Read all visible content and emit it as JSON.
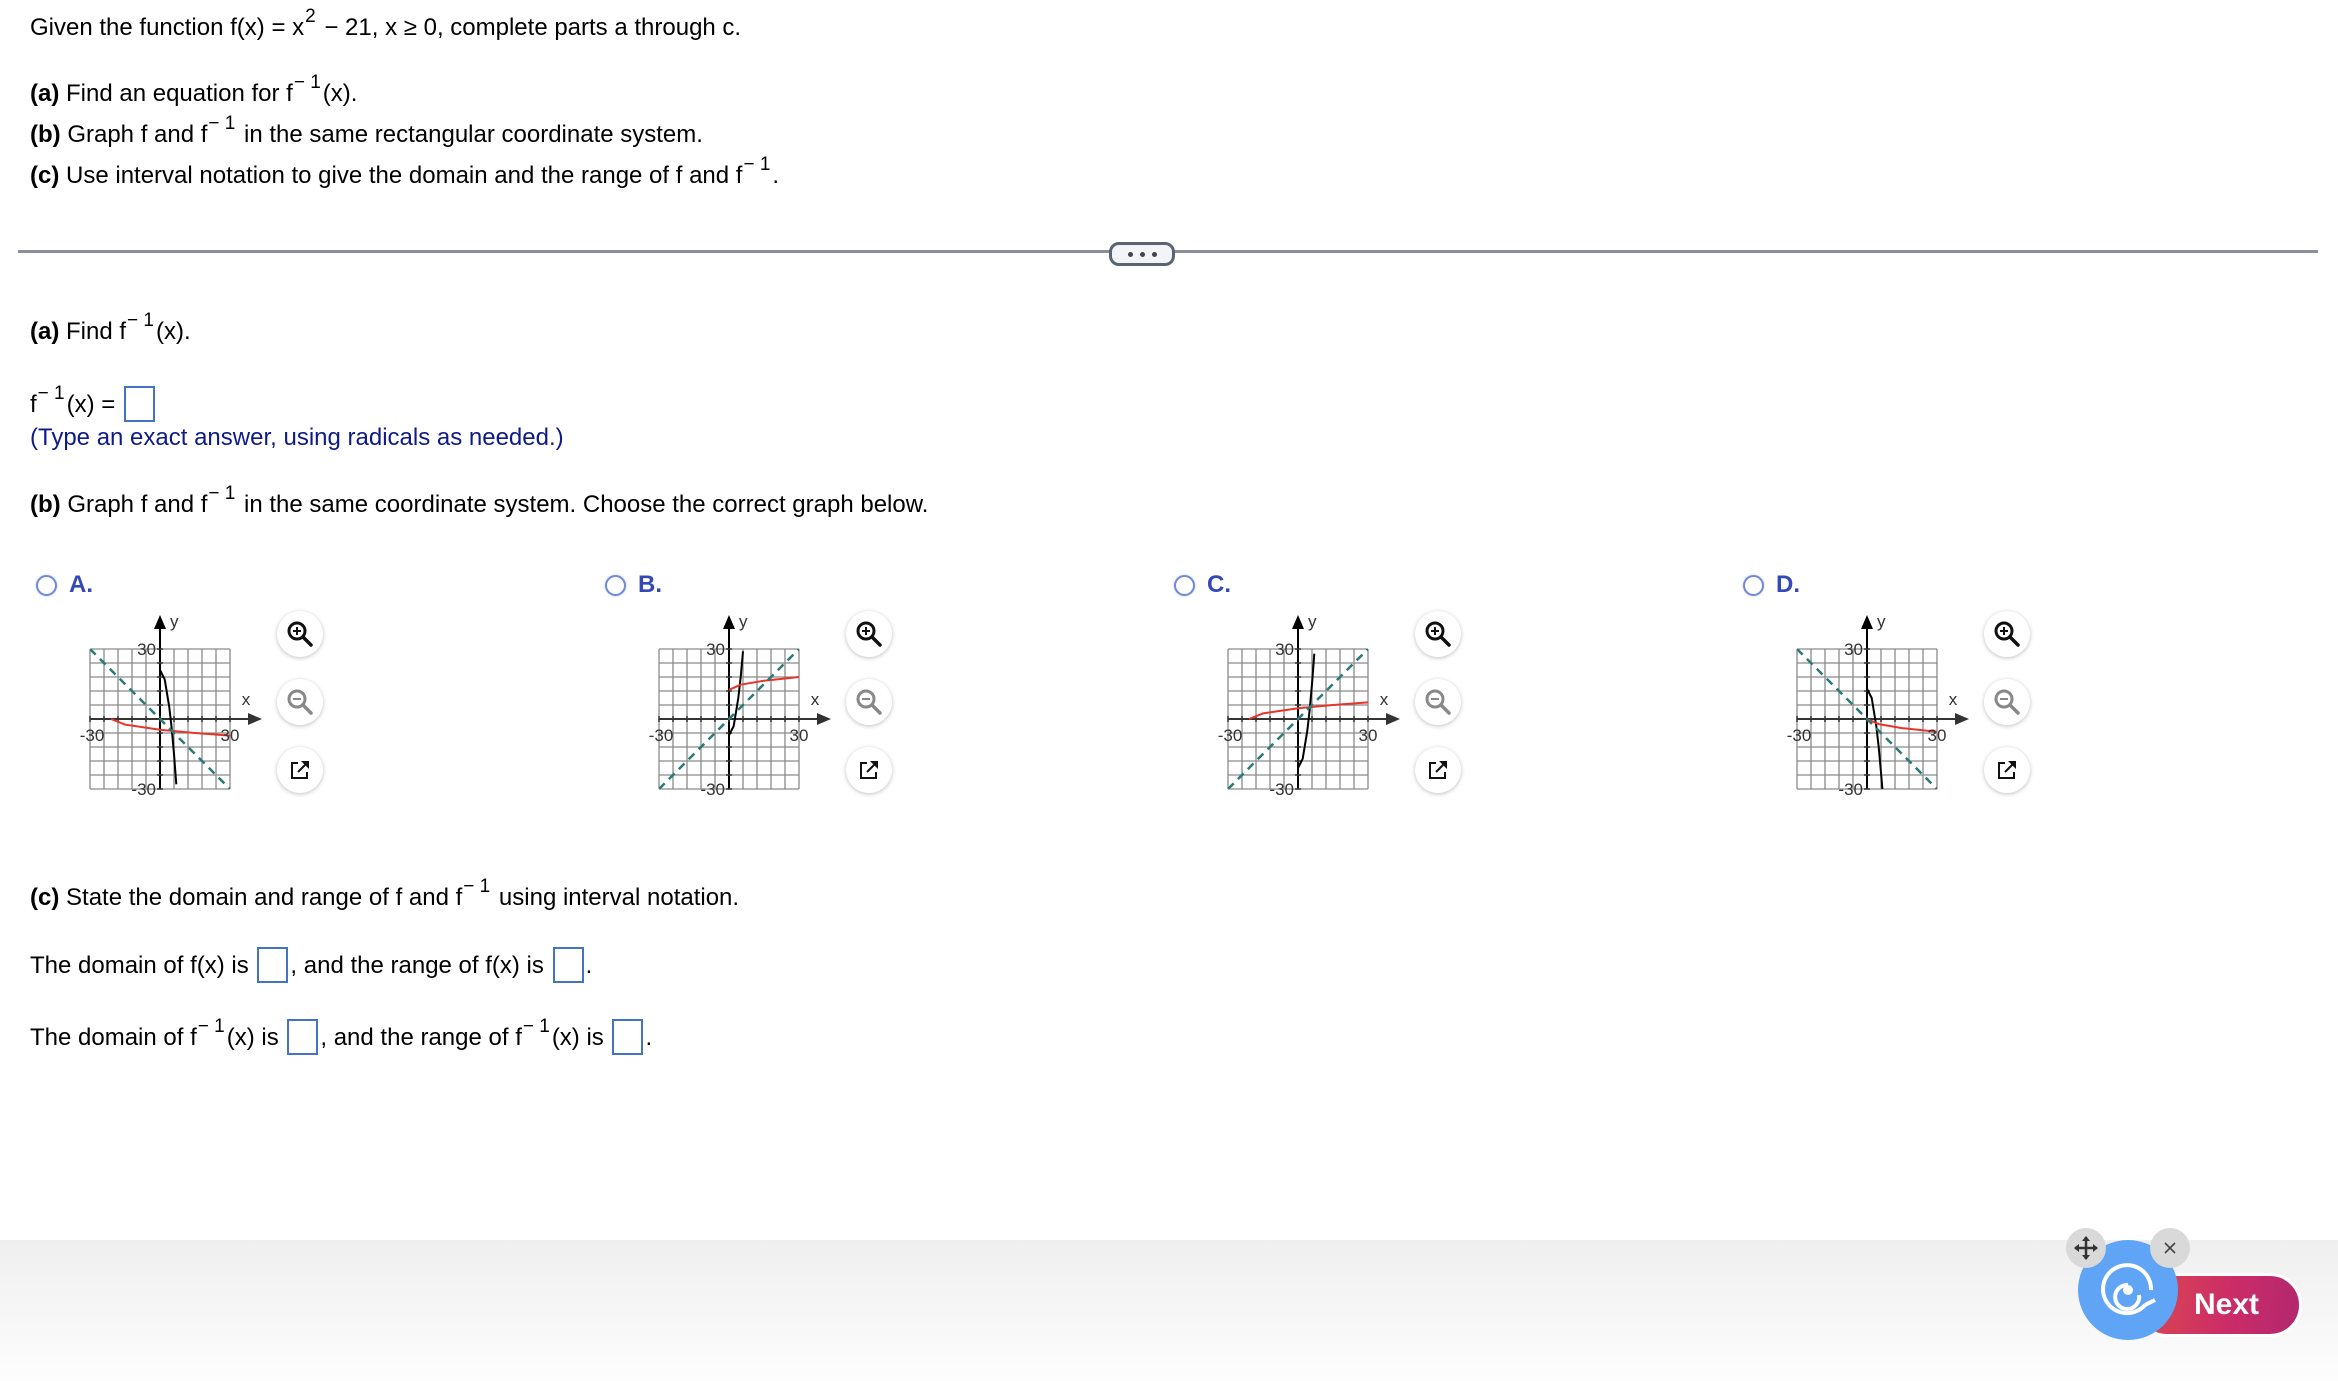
{
  "question": {
    "intro_pre": "Given the function f(x) = x",
    "intro_exp": "2",
    "intro_post": " − 21, x ≥ 0, complete parts a through c.",
    "parts": [
      {
        "letter": "(a)",
        "pre": " Find an equation for f",
        "sup": "− 1",
        "post": "(x)."
      },
      {
        "letter": "(b)",
        "pre": " Graph f and f",
        "sup": "− 1",
        "post": " in the same rectangular coordinate system."
      },
      {
        "letter": "(c)",
        "pre": " Use interval notation to give the domain and the range of f and f",
        "sup": "− 1",
        "post": "."
      }
    ]
  },
  "divider": {
    "more_label": "..."
  },
  "part_a": {
    "heading_letter": "(a)",
    "heading_pre": " Find f",
    "heading_sup": "− 1",
    "heading_post": "(x).",
    "eq_pre": "f",
    "eq_sup": "− 1",
    "eq_post": "(x) =",
    "answer_value": "",
    "hint": "(Type an exact answer, using radicals as needed.)"
  },
  "part_b": {
    "heading_letter": "(b)",
    "heading_pre": " Graph f and f",
    "heading_sup": "− 1",
    "heading_post": " in the same coordinate system. Choose the correct graph below.",
    "options": [
      {
        "label": "A.",
        "selected": false
      },
      {
        "label": "B.",
        "selected": false
      },
      {
        "label": "C.",
        "selected": false
      },
      {
        "label": "D.",
        "selected": false
      }
    ],
    "graph_axis": {
      "xlabel": "x",
      "ylabel": "y",
      "min_label": "-30",
      "max_label": "30",
      "neg_y_label": "-30",
      "pos_y_label": "30"
    },
    "graph_icons": [
      "zoom-in-icon",
      "zoom-out-icon",
      "external-link-icon"
    ]
  },
  "chart_data": [
    {
      "type": "line",
      "title": "Option A",
      "xlim": [
        -30,
        30
      ],
      "ylim": [
        -30,
        30
      ],
      "grid": true,
      "grid_step": 6,
      "series": [
        {
          "name": "black curve",
          "color": "#000000",
          "formula": "y = 21 - x^2, x >= 0",
          "points": [
            [
              0,
              21
            ],
            [
              2,
              17
            ],
            [
              4,
              5
            ],
            [
              5,
              -4
            ],
            [
              6,
              -15
            ],
            [
              7,
              -28
            ]
          ]
        },
        {
          "name": "red curve",
          "color": "#e8342b",
          "formula": "y = -sqrt(x + 21), x >= -21",
          "points": [
            [
              -21,
              0
            ],
            [
              -15,
              -2.4
            ],
            [
              0,
              -4.6
            ],
            [
              15,
              -6
            ],
            [
              30,
              -7.1
            ]
          ]
        },
        {
          "name": "dashed line",
          "color": "#2b7a78",
          "formula": "y = -x",
          "dashed": true,
          "points": [
            [
              -30,
              30
            ],
            [
              30,
              -30
            ]
          ]
        }
      ]
    },
    {
      "type": "line",
      "title": "Option B",
      "xlim": [
        -30,
        30
      ],
      "ylim": [
        -30,
        30
      ],
      "grid": true,
      "grid_step": 6,
      "series": [
        {
          "name": "black curve",
          "color": "#000000",
          "formula": "y = x^2 - 7, x >= 0",
          "points": [
            [
              0,
              -7
            ],
            [
              2,
              -3
            ],
            [
              4,
              9
            ],
            [
              5,
              18
            ],
            [
              6,
              29
            ]
          ]
        },
        {
          "name": "red curve",
          "color": "#e8342b",
          "formula": "y = sqrt(x) + 12.5, x >= 0",
          "points": [
            [
              0,
              12.5
            ],
            [
              5,
              14.7
            ],
            [
              15,
              16.4
            ],
            [
              30,
              18
            ]
          ]
        },
        {
          "name": "dashed line",
          "color": "#2b7a78",
          "formula": "y = x",
          "dashed": true,
          "points": [
            [
              -30,
              -30
            ],
            [
              30,
              30
            ]
          ]
        }
      ]
    },
    {
      "type": "line",
      "title": "Option C",
      "xlim": [
        -30,
        30
      ],
      "ylim": [
        -30,
        30
      ],
      "grid": true,
      "grid_step": 6,
      "series": [
        {
          "name": "black curve",
          "color": "#000000",
          "formula": "y = x^2 - 21, x >= 0",
          "points": [
            [
              0,
              -21
            ],
            [
              2,
              -17
            ],
            [
              4,
              -5
            ],
            [
              5,
              4
            ],
            [
              6,
              15
            ],
            [
              7,
              28
            ]
          ]
        },
        {
          "name": "red curve",
          "color": "#e8342b",
          "formula": "y = sqrt(x + 21), x >= -21",
          "points": [
            [
              -21,
              0
            ],
            [
              -15,
              2.4
            ],
            [
              0,
              4.6
            ],
            [
              15,
              6
            ],
            [
              30,
              7.1
            ]
          ]
        },
        {
          "name": "dashed line",
          "color": "#2b7a78",
          "formula": "y = x",
          "dashed": true,
          "points": [
            [
              -30,
              -30
            ],
            [
              30,
              30
            ]
          ]
        }
      ]
    },
    {
      "type": "line",
      "title": "Option D",
      "xlim": [
        -30,
        30
      ],
      "ylim": [
        -30,
        30
      ],
      "grid": true,
      "grid_step": 6,
      "series": [
        {
          "name": "black curve",
          "color": "#000000",
          "formula": "y = 13 - x^2, x >= 0",
          "points": [
            [
              0,
              13
            ],
            [
              2,
              9
            ],
            [
              4,
              -3
            ],
            [
              5,
              -12
            ],
            [
              6,
              -23
            ],
            [
              6.6,
              -30
            ]
          ]
        },
        {
          "name": "red curve",
          "color": "#e8342b",
          "formula": "y = -sqrt(x), x >= 0",
          "points": [
            [
              0,
              0
            ],
            [
              5,
              -2.2
            ],
            [
              15,
              -3.9
            ],
            [
              30,
              -5.5
            ]
          ]
        },
        {
          "name": "dashed line",
          "color": "#2b7a78",
          "formula": "y = -x",
          "dashed": true,
          "points": [
            [
              -30,
              30
            ],
            [
              30,
              -30
            ]
          ]
        }
      ]
    }
  ],
  "part_c": {
    "heading_letter": "(c)",
    "heading_pre": " State the domain and range of f and f",
    "heading_sup": "− 1",
    "heading_post": " using interval notation.",
    "line1_a": "The domain of f(x) is",
    "line1_b": ", and the range of f(x) is",
    "line1_c": ".",
    "line2_a": "The domain of f",
    "line2_sup": "− 1",
    "line2_b": "(x) is",
    "line2_c": ", and the range of f",
    "line2_sup2": "− 1",
    "line2_d": "(x) is",
    "line2_e": "."
  },
  "footer": {
    "next_label": "Next",
    "assistant_icon": "assistant-logo-icon",
    "move_icon": "move-icon",
    "close_icon": "close-icon"
  },
  "colors": {
    "answer_box": "#4472c4",
    "option_label": "#3449b8",
    "hint_text": "#0e1a8a",
    "next_button": "#cc2d66",
    "assistant": "#60a4f5"
  }
}
